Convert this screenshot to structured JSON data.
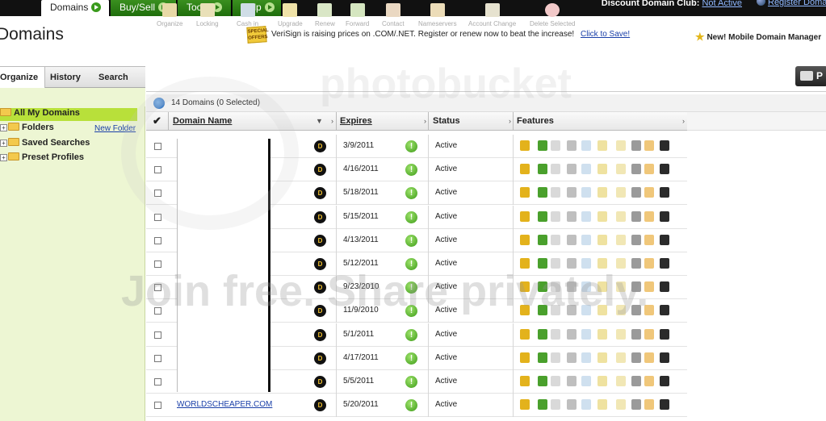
{
  "nav": {
    "tabs": [
      {
        "label": "Domains",
        "active": true
      },
      {
        "label": "Buy/Sell",
        "active": false
      },
      {
        "label": "Tools",
        "active": false
      },
      {
        "label": "Help",
        "active": false
      }
    ],
    "club_label": "Discount Domain Club:",
    "club_status": "Not Active",
    "register_link": "Register Domain"
  },
  "header": {
    "title": "Domains",
    "special_badge": "SPECIAL OFFERS",
    "promo_text": "VeriSign is raising prices on .COM/.NET. Register or renew now to beat the increase!",
    "promo_link": "Click to Save!",
    "mobile_text": "New! Mobile Domain Manager"
  },
  "sidebar": {
    "tabs": [
      "Organize",
      "History",
      "Search"
    ],
    "tree": {
      "all_domains": "All My Domains",
      "folders": "Folders",
      "new_folder": "New Folder",
      "saved_searches": "Saved Searches",
      "preset_profiles": "Preset Profiles"
    }
  },
  "toolbar": {
    "items": [
      {
        "label": "Organize",
        "icon": "folder-icon"
      },
      {
        "label": "Locking",
        "icon": "lock-icon"
      },
      {
        "label": "Cash in",
        "icon": "cash-icon"
      },
      {
        "label": "Upgrade",
        "icon": "upgrade-icon"
      },
      {
        "label": "Renew",
        "icon": "renew-icon"
      },
      {
        "label": "Forward",
        "icon": "forward-icon"
      },
      {
        "label": "Contact",
        "icon": "contact-icon"
      },
      {
        "label": "Nameservers",
        "icon": "nameservers-icon"
      },
      {
        "label": "Account Change",
        "icon": "account-change-icon"
      },
      {
        "label": "Delete Selected",
        "icon": "delete-icon"
      }
    ],
    "print_label": "P"
  },
  "grid": {
    "summary": "14 Domains (0 Selected)",
    "columns": {
      "domain_name": "Domain Name",
      "expires": "Expires",
      "status": "Status",
      "features": "Features"
    },
    "rows": [
      {
        "domain": "",
        "expires": "3/9/2011",
        "status": "Active"
      },
      {
        "domain": "",
        "expires": "4/16/2011",
        "status": "Active"
      },
      {
        "domain": "",
        "expires": "5/18/2011",
        "status": "Active"
      },
      {
        "domain": "",
        "expires": "5/15/2011",
        "status": "Active"
      },
      {
        "domain": "",
        "expires": "4/13/2011",
        "status": "Active"
      },
      {
        "domain": "",
        "expires": "5/12/2011",
        "status": "Active"
      },
      {
        "domain": "",
        "expires": "9/23/2010",
        "status": "Active"
      },
      {
        "domain": "",
        "expires": "11/9/2010",
        "status": "Active"
      },
      {
        "domain": "",
        "expires": "5/1/2011",
        "status": "Active"
      },
      {
        "domain": "",
        "expires": "4/17/2011",
        "status": "Active"
      },
      {
        "domain": "",
        "expires": "5/5/2011",
        "status": "Active"
      },
      {
        "domain": "WORLDSCHEAPER.COM",
        "expires": "5/20/2011",
        "status": "Active"
      }
    ],
    "feature_icons": [
      "lock-icon",
      "sync-icon",
      "cash-icon",
      "parking-icon",
      "search-icon",
      "shield-icon",
      "star-icon",
      "bulb-icon",
      "sun-icon",
      "chart-icon"
    ],
    "feature_colors": [
      "#e3b21c",
      "#4aa02c",
      "#d9d9d9",
      "#bfbfbf",
      "#cfe0ef",
      "#efe2a0",
      "#f1e7b5",
      "#9a9a9a",
      "#f0c77a",
      "#2b2b2b"
    ]
  },
  "watermark": {
    "line1": "photobucket",
    "line2": "Join free. Share privately."
  }
}
